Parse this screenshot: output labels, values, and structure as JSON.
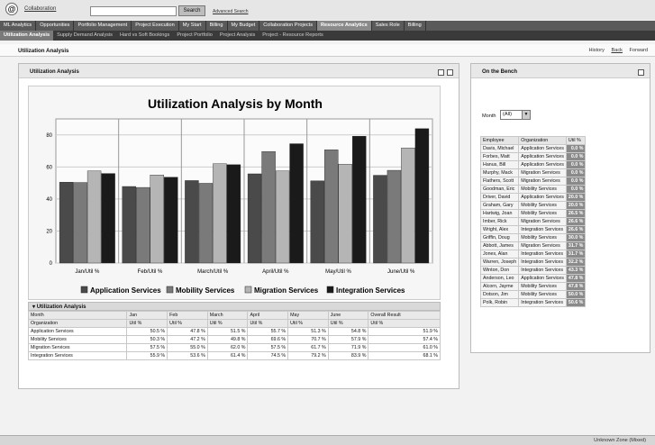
{
  "topbar": {
    "logo": "@",
    "collab_link": "Collaboration",
    "search_button": "Search",
    "advanced_search": "Advanced Search"
  },
  "nav": {
    "tabs": [
      "ML Analytics",
      "Opportunities",
      "Portfolio Management",
      "Project Execution",
      "My Start",
      "Billing",
      "My Budget",
      "Collaboration Projects",
      "Resource Analytics",
      "Sales Role",
      "Billing"
    ],
    "active": 8,
    "subtabs": [
      "Utilization Analysis",
      "Supply Demand Analysis",
      "Hard vs Soft Bookings",
      "Project Portfolio",
      "Project Analysis",
      "Project - Resource Reports"
    ],
    "subactive": 0
  },
  "page": {
    "title": "Utilization Analysis",
    "history": "History",
    "back": "Back",
    "forward": "Forward"
  },
  "left_panel": {
    "title": "Utilization Analysis"
  },
  "chart_data": {
    "type": "bar",
    "title": "Utilization Analysis by Month",
    "categories": [
      "Jan/Util %",
      "Feb/Util %",
      "March/Util %",
      "April/Util %",
      "May/Util %",
      "June/Util %"
    ],
    "series": [
      {
        "name": "Application Services",
        "values": [
          50.5,
          47.8,
          51.5,
          55.7,
          51.3,
          54.8
        ]
      },
      {
        "name": "Mobility Services",
        "values": [
          50.3,
          47.2,
          49.8,
          69.6,
          70.7,
          57.9
        ]
      },
      {
        "name": "Migration Services",
        "values": [
          57.5,
          55.0,
          62.0,
          57.5,
          61.7,
          71.9
        ]
      },
      {
        "name": "Integration Services",
        "values": [
          55.9,
          53.6,
          61.4,
          74.5,
          79.2,
          83.9
        ]
      }
    ],
    "colors": [
      "#4a4a4a",
      "#7a7a7a",
      "#b5b5b5",
      "#1a1a1a"
    ],
    "yticks": [
      "0",
      "20",
      "40",
      "60",
      "80"
    ],
    "ylim": [
      0,
      90
    ],
    "legend_position": "bottom"
  },
  "table": {
    "title": "Utilization Analysis",
    "header1": [
      "Month",
      "Jan",
      "Feb",
      "March",
      "April",
      "May",
      "June",
      "Overall Result"
    ],
    "header2": [
      "Organization",
      "Util %",
      "Util %",
      "Util %",
      "Util %",
      "Util %",
      "Util %",
      "Util %"
    ],
    "rows": [
      [
        "Application Services",
        "50.5 %",
        "47.8 %",
        "51.5 %",
        "55.7 %",
        "51.3 %",
        "54.8 %",
        "51.9 %"
      ],
      [
        "Mobility Services",
        "50.3 %",
        "47.2 %",
        "49.8 %",
        "69.6 %",
        "70.7 %",
        "57.9 %",
        "57.4 %"
      ],
      [
        "Migration Services",
        "57.5 %",
        "55.0 %",
        "62.0 %",
        "57.5 %",
        "61.7 %",
        "71.9 %",
        "61.0 %"
      ],
      [
        "Integration Services",
        "55.9 %",
        "53.6 %",
        "61.4 %",
        "74.5 %",
        "79.2 %",
        "83.9 %",
        "68.1 %"
      ]
    ]
  },
  "bench": {
    "title": "On the Bench",
    "month_label": "Month",
    "month_value": "(All)",
    "headers": [
      "Employee",
      "Organization",
      "Util %"
    ],
    "rows": [
      [
        "Davis, Michael",
        "Application Services",
        "0.0 %"
      ],
      [
        "Forbes, Matt",
        "Application Services",
        "0.0 %"
      ],
      [
        "Hanus, Bill",
        "Application Services",
        "0.0 %"
      ],
      [
        "Murphy, Mack",
        "Migration Services",
        "0.0 %"
      ],
      [
        "Flathers, Scott",
        "Migration Services",
        "0.0 %"
      ],
      [
        "Goodman, Eric",
        "Mobility Services",
        "0.0 %"
      ],
      [
        "Driver, David",
        "Application Services",
        "20.0 %"
      ],
      [
        "Graham, Gary",
        "Mobility Services",
        "20.0 %"
      ],
      [
        "Hartwig, Joan",
        "Mobility Services",
        "26.5 %"
      ],
      [
        "Imber, Rick",
        "Migration Services",
        "26.6 %"
      ],
      [
        "Wright, Alex",
        "Integration Services",
        "26.6 %"
      ],
      [
        "Griffin, Doug",
        "Mobility Services",
        "30.0 %"
      ],
      [
        "Abbott, James",
        "Migration Services",
        "31.7 %"
      ],
      [
        "Jones, Alan",
        "Integration Services",
        "31.7 %"
      ],
      [
        "Warren, Joseph",
        "Integration Services",
        "32.2 %"
      ],
      [
        "Winton, Don",
        "Integration Services",
        "43.3 %"
      ],
      [
        "Anderson, Leo",
        "Application Services",
        "47.8 %"
      ],
      [
        "Alcorn, Jayme",
        "Mobility Services",
        "47.8 %"
      ],
      [
        "Dotson, Jim",
        "Mobility Services",
        "50.0 %"
      ],
      [
        "Polk, Robin",
        "Integration Services",
        "50.6 %"
      ]
    ]
  },
  "status": {
    "zone": "Unknown Zone (Mixed)"
  }
}
